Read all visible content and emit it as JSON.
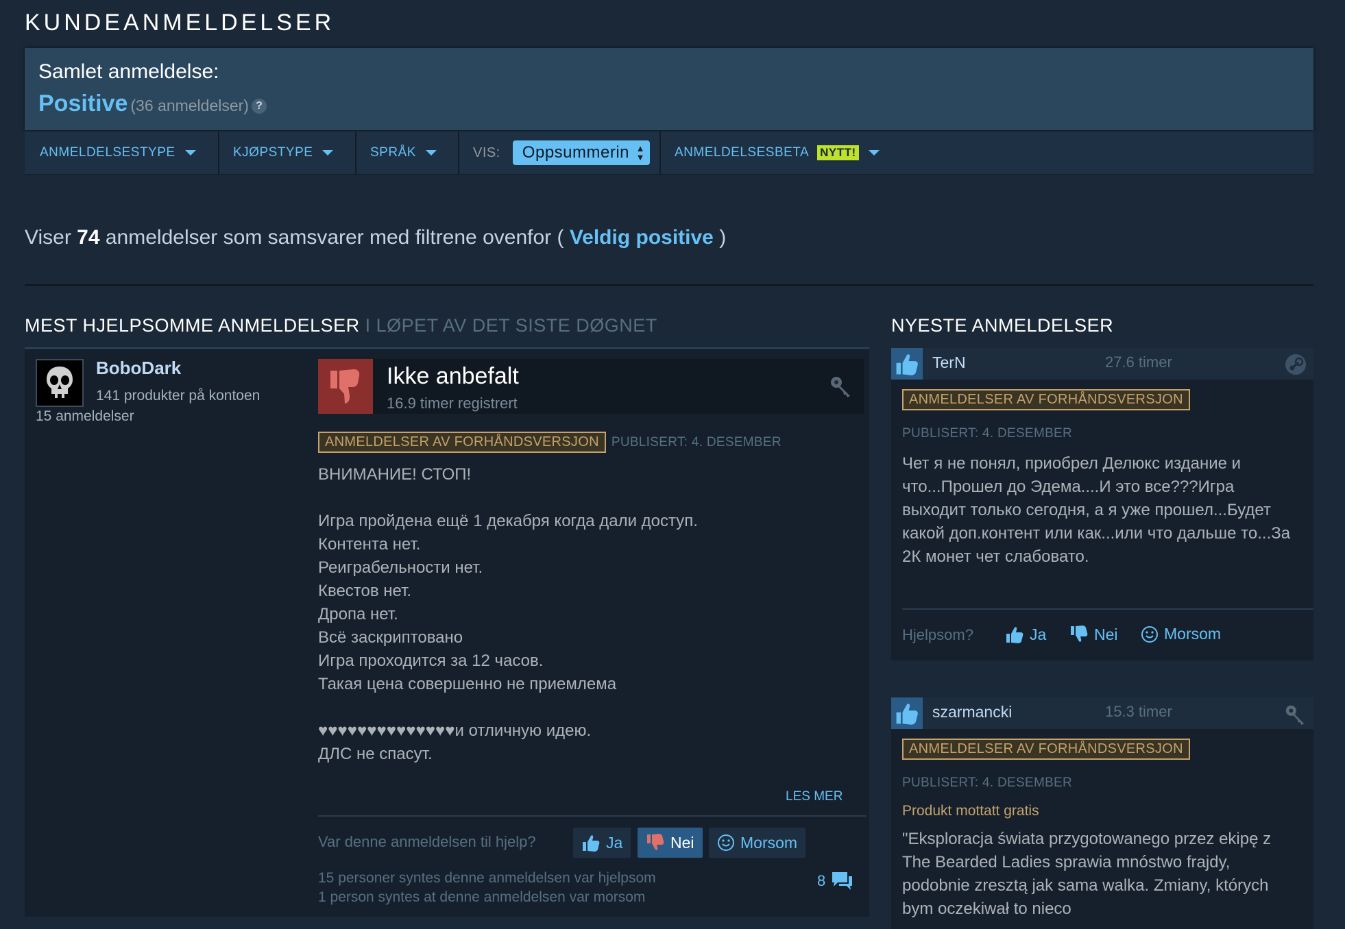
{
  "section_title": "KUNDEANMELDELSER",
  "summary": {
    "label": "Samlet anmeldelse:",
    "rating": "Positive",
    "count": "(36 anmeldelser)",
    "help": "?"
  },
  "filters": {
    "review_type": "ANMELDELSESTYPE",
    "purchase_type": "KJØPSTYPE",
    "language": "SPRÅK",
    "view_label": "VIS:",
    "view_value": "Oppsummerin",
    "beta": "ANMELDELSESBETA",
    "new_badge": "NYTT!"
  },
  "showing": {
    "prefix": "Viser",
    "count": "74",
    "middle": "anmeldelser som samsvarer med filtrene ovenfor (",
    "rating": "Veldig positive",
    "suffix": ")"
  },
  "most_helpful": {
    "title": "MEST HJELPSOMME ANMELDELSER",
    "subtitle": "I LØPET AV DET SISTE DØGNET",
    "review": {
      "author": "BoboDark",
      "products": "141 produkter på kontoen",
      "reviews": "15 anmeldelser",
      "verdict": "Ikke anbefalt",
      "hours": "16.9 timer registrert",
      "badge": "ANMELDELSER AV FORHÅNDSVERSJON",
      "published": "PUBLISERT: 4. DESEMBER",
      "text": "ВНИМАНИЕ! СТОП!\n\nИгра пройдена ещё 1 декабря когда дали доступ.\nКонтента нет.\nРеиграбельности нет.\nКвестов нет.\nДропа нет.\nВсё заскриптовано\nИгра проходится за 12 часов.\nТакая цена совершенно не приемлема\n\n♥♥♥♥♥♥♥♥♥♥♥♥♥♥и отличную идею.\nДЛС не спасут.",
      "read_more": "LES MER",
      "helpful_question": "Var denne anmeldelsen til hjelp?",
      "yes": "Ja",
      "no": "Nei",
      "funny": "Morsom",
      "stats_helpful": "15 personer syntes denne anmeldelsen var hjelpsom",
      "stats_funny": "1 person syntes at denne anmeldelsen var morsom",
      "comments": "8"
    }
  },
  "newest": {
    "title": "NYESTE ANMELDELSER",
    "reviews": [
      {
        "author": "TerN",
        "hours": "27.6 timer",
        "badge": "ANMELDELSER AV FORHÅNDSVERSJON",
        "published": "PUBLISERT: 4. DESEMBER",
        "text": "Чет я не понял, приобрел Делюкс издание и что...Прошел до Эдема....И это все???Игра выходит только сегодня, а я уже прошел...Будет какой доп.контент или как...или что дальше то...За 2К монет чет слабовато.",
        "helpful_label": "Hjelpsom?",
        "yes": "Ja",
        "no": "Nei",
        "funny": "Morsom"
      },
      {
        "author": "szarmancki",
        "hours": "15.3 timer",
        "badge": "ANMELDELSER AV FORHÅNDSVERSJON",
        "published": "PUBLISERT: 4. DESEMBER",
        "free": "Produkt mottatt gratis",
        "text": "\"Eksploracja świata przygotowanego przez ekipę z The Bearded Ladies sprawia mnóstwo frajdy, podobnie zresztą jak sama walka. Zmiany, których bym oczekiwał to nieco"
      }
    ]
  },
  "colors": {
    "background": "#1b2838",
    "accent": "#66c0f4",
    "summary_bg": "#2a475e",
    "badge_gold": "#c4a26a",
    "new_badge": "#bde12c",
    "thumb_down": "#8b2e2e"
  },
  "icons": [
    "chevron-down-icon",
    "help-icon",
    "thumbs-up-icon",
    "thumbs-down-icon",
    "smiley-icon",
    "key-icon",
    "steam-icon",
    "comment-icon",
    "skull-avatar-icon"
  ]
}
